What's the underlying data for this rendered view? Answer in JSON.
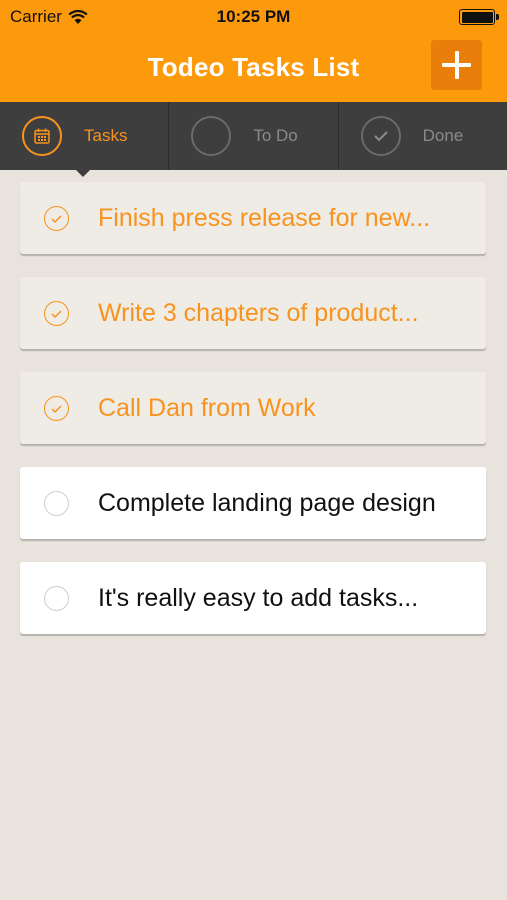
{
  "status_bar": {
    "carrier": "Carrier",
    "time": "10:25 PM"
  },
  "header": {
    "title": "Todeo Tasks List",
    "add_icon": "plus-icon"
  },
  "tabs": [
    {
      "label": "Tasks",
      "icon": "calendar-icon",
      "active": true
    },
    {
      "label": "To Do",
      "icon": "circle-icon",
      "active": false
    },
    {
      "label": "Done",
      "icon": "check-icon",
      "active": false
    }
  ],
  "tasks": [
    {
      "text": "Finish press release for new...",
      "done": true
    },
    {
      "text": "Write 3 chapters of product...",
      "done": true
    },
    {
      "text": "Call Dan from Work",
      "done": true
    },
    {
      "text": "Complete landing page design",
      "done": false
    },
    {
      "text": "It's really easy to add tasks...",
      "done": false
    }
  ],
  "colors": {
    "accent": "#fd9a0c",
    "accent_dark": "#e97f0a",
    "tabbar": "#3e3e3e",
    "background": "#e8e3dc",
    "done_text": "#f7931e"
  }
}
